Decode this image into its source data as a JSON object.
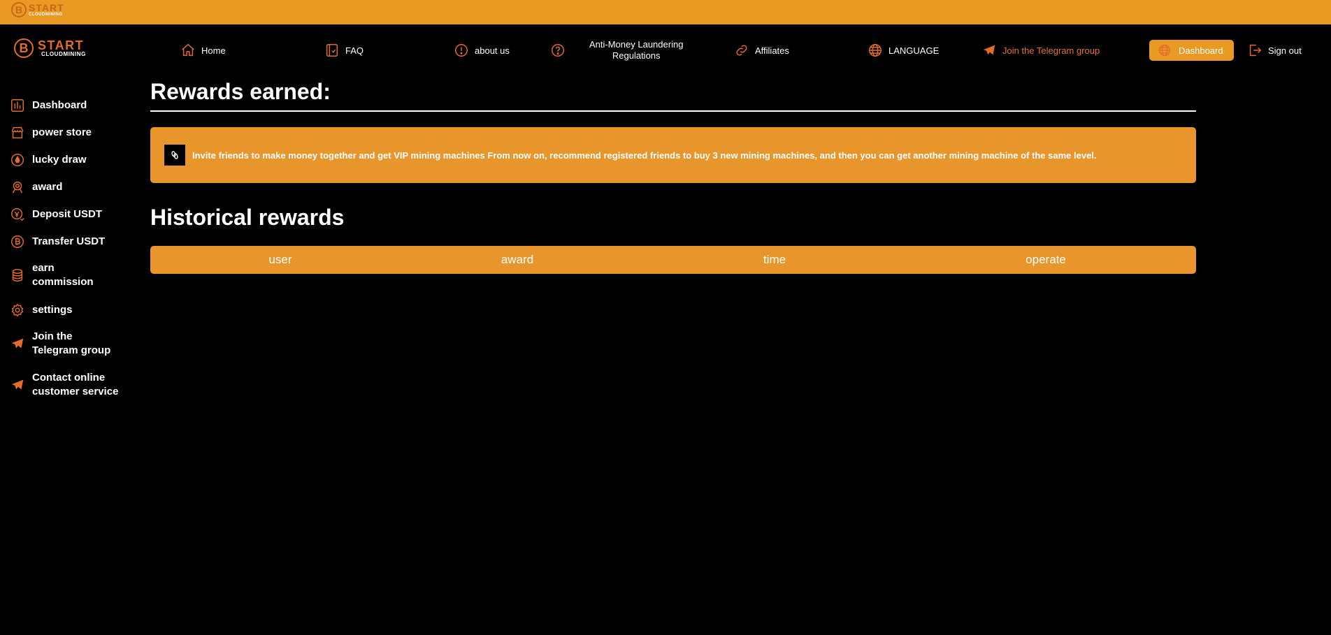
{
  "brand": {
    "name": "START",
    "sub": "CLOUDMINING"
  },
  "nav": {
    "home": "Home",
    "faq": "FAQ",
    "about": "about us",
    "aml_line1": "Anti-Money Laundering",
    "aml_line2": "Regulations",
    "affiliates": "Affiliates",
    "language": "LANGUAGE",
    "telegram": "Join the Telegram group",
    "dashboard": "Dashboard",
    "signout": "Sign out"
  },
  "sidebar": {
    "items": [
      {
        "label": "Dashboard",
        "icon": "bar-chart-icon"
      },
      {
        "label": "power store",
        "icon": "store-icon"
      },
      {
        "label": "lucky draw",
        "icon": "drop-icon"
      },
      {
        "label": "award",
        "icon": "award-icon"
      },
      {
        "label": "Deposit USDT",
        "icon": "deposit-icon"
      },
      {
        "label": "Transfer USDT",
        "icon": "bitcoin-icon"
      },
      {
        "label": "earn commission",
        "line1": "earn",
        "line2": "commission",
        "icon": "coins-icon"
      },
      {
        "label": "settings",
        "icon": "gear-icon"
      },
      {
        "label": "Join the Telegram group",
        "line1": "Join the",
        "line2": "Telegram group",
        "icon": "telegram-icon"
      },
      {
        "label": "Contact online customer service",
        "line1": "Contact online",
        "line2": "customer service",
        "icon": "telegram-icon"
      }
    ]
  },
  "main": {
    "rewards_title": "Rewards earned:",
    "notice": "Invite friends to make money together and get VIP mining machines From now on, recommend registered friends to buy 3 new mining machines, and then you can get another mining machine of the same level.",
    "history_title": "Historical rewards",
    "columns": [
      "user",
      "award",
      "time",
      "operate"
    ]
  },
  "colors": {
    "accent": "#e89a22",
    "icon": "#e36b2c",
    "background": "#000000"
  }
}
